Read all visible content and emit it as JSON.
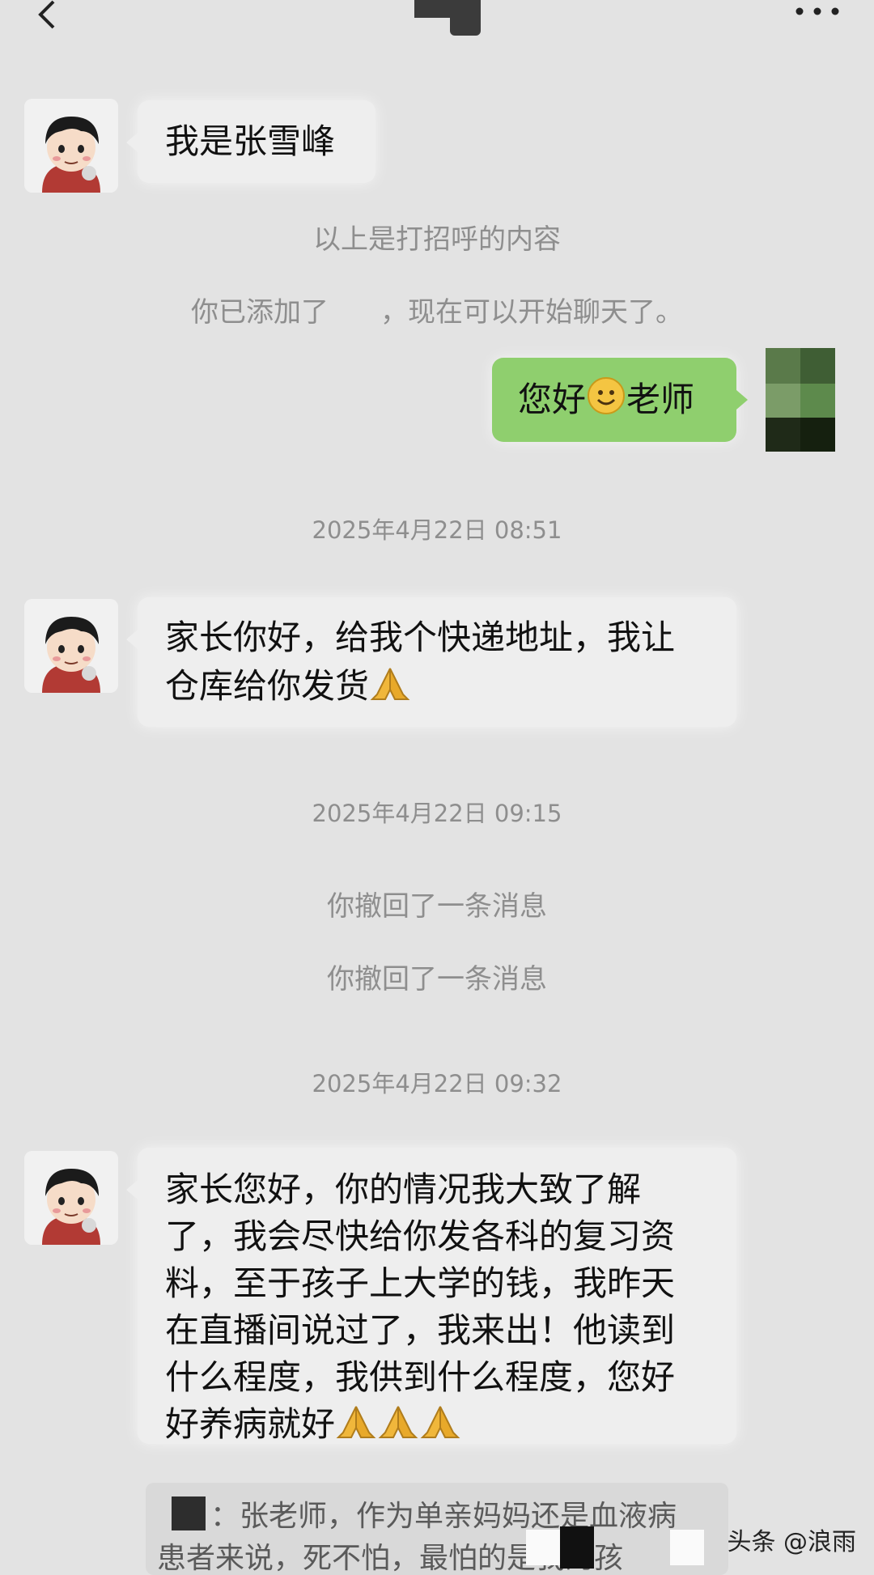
{
  "header": {
    "back_label": "‹",
    "more_label": "···"
  },
  "messages": {
    "m1": "我是张雪峰",
    "sys1": "以上是打招呼的内容",
    "sys2": "你已添加了",
    "sys2_tail": "，现在可以开始聊天了。",
    "out1_pre": "您好",
    "out1_post": "老师",
    "ts1": "2025年4月22日 08:51",
    "m2_line1": "家长你好，给我个快递地址，我让",
    "m2_line2": "仓库给你发货",
    "ts2": "2025年4月22日 09:15",
    "recall1": "你撤回了一条消息",
    "recall2": "你撤回了一条消息",
    "ts3": "2025年4月22日 09:32",
    "m3_lines": [
      "家长您好，你的情况我大致了解",
      "了，我会尽快给你发各科的复习资",
      "料，至于孩子上大学的钱，我昨天",
      "在直播间说过了，我来出！他读到",
      "什么程度，我供到什么程度，您好",
      "好养病就好"
    ]
  },
  "quote": {
    "line1": "：张老师，作为单亲妈妈还是血液病",
    "line2": "患者来说，死不怕，最怕的是我的孩"
  },
  "watermark": {
    "text": "头条 @浪雨"
  },
  "icons": [
    "back-icon",
    "more-icon",
    "smile-emoji-icon",
    "pray-hands-icon"
  ],
  "colors": {
    "background": "#e3e3e3",
    "bubble_in": "#eeeeee",
    "bubble_out": "#8fcf6e"
  }
}
